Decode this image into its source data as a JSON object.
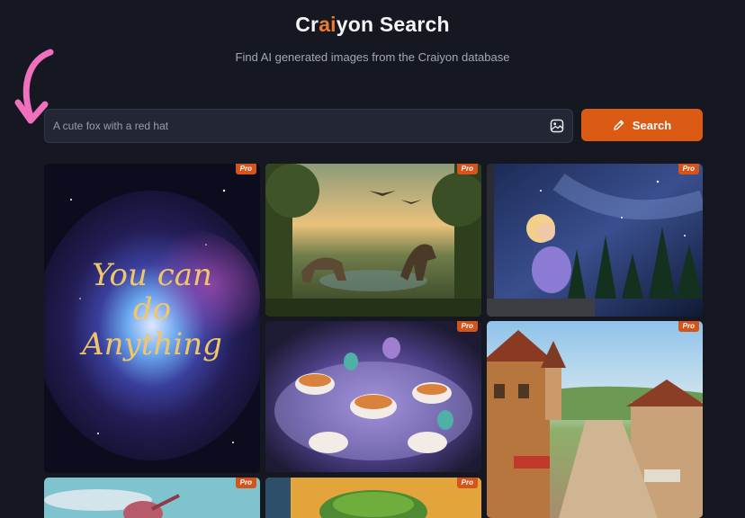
{
  "header": {
    "title_prefix": "Cr",
    "title_highlight": "ai",
    "title_suffix": "yon Search",
    "subtitle": "Find AI generated images from the Craiyon database"
  },
  "search": {
    "placeholder": "A cute fox with a red hat",
    "image_icon": "image-upload-icon",
    "button_label": "Search",
    "button_icon": "pencil-icon"
  },
  "colors": {
    "background": "#151821",
    "accent": "#db5a14",
    "title_highlight": "#ee7a2f",
    "arrow": "#f06fbf"
  },
  "gallery": {
    "badge": "Pro",
    "images": [
      {
        "name": "galaxy-quote-image",
        "text_lines": [
          "You can",
          "do",
          "Anything"
        ]
      },
      {
        "name": "dinosaur-jungle-image"
      },
      {
        "name": "girl-starry-night-image"
      },
      {
        "name": "alien-tea-party-image"
      },
      {
        "name": "medieval-village-image"
      },
      {
        "name": "bird-sky-image"
      },
      {
        "name": "green-monster-image"
      }
    ]
  }
}
